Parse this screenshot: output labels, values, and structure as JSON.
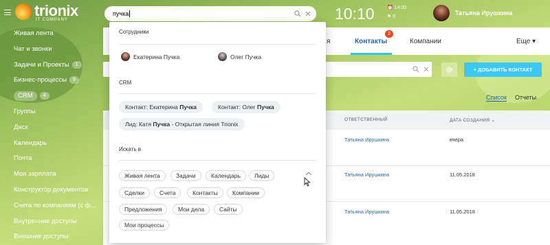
{
  "brand": {
    "name": "trionix",
    "subtitle": "IT COMPANY"
  },
  "search": {
    "value": "пучка"
  },
  "header": {
    "time": "10:10",
    "alarm": "14:00",
    "flags": "0",
    "user_name": "Татьяна Ирушкина"
  },
  "sidebar": {
    "items": [
      {
        "label": "Живая лента",
        "count": ""
      },
      {
        "label": "Чат и звонки",
        "count": ""
      },
      {
        "label": "Задачи и Проекты",
        "count": "1"
      },
      {
        "label": "Бизнес-процессы",
        "count": "9"
      },
      {
        "label": "CRM",
        "count": "4"
      },
      {
        "label": "Группы",
        "count": ""
      },
      {
        "label": "Диск",
        "count": ""
      },
      {
        "label": "Календарь",
        "count": ""
      },
      {
        "label": "Почта",
        "count": ""
      },
      {
        "label": "Моя зарплата",
        "count": ""
      },
      {
        "label": "Конструктор документов",
        "count": ""
      },
      {
        "label": "Счета по компаниям (с ф...",
        "count": ""
      },
      {
        "label": "Внутренние доступы",
        "count": ""
      },
      {
        "label": "Внешние доступы",
        "count": ""
      }
    ]
  },
  "tabs": {
    "partial": "я",
    "contacts": "Контакты",
    "contacts_badge": "3",
    "companies": "Компании",
    "more": "Еще"
  },
  "toolbar": {
    "add_contact": "+ ДОБАВИТЬ КОНТАКТ"
  },
  "views": {
    "list": "Список",
    "reports": "Отчеты"
  },
  "table": {
    "headers": {
      "responsible": "ОТВЕТСТВЕННЫЙ",
      "created": "ДАТА СОЗДАНИЯ"
    },
    "rows": [
      {
        "responsible": "Татьяна Ирушкина",
        "created": "вчера"
      },
      {
        "responsible": "Татьяна Ирушкина",
        "created": "11.05.2018"
      },
      {
        "responsible": "Татьяна Ирушкина",
        "created": "11.05.2018"
      }
    ]
  },
  "dropdown": {
    "employees_title": "Сотрудники",
    "employees": [
      "Екатерина Пучка",
      "Олег Пучка"
    ],
    "crm_title": "CRM",
    "crm_results": [
      {
        "prefix": "Контакт: Екатерина ",
        "bold": "Пучка",
        "suffix": ""
      },
      {
        "prefix": "Контакт: Олег ",
        "bold": "Пучка",
        "suffix": ""
      },
      {
        "prefix": "Лид: Катя ",
        "bold": "Пучка",
        "suffix": " - Открытая линия Trionix"
      }
    ],
    "search_in_title": "Искать в",
    "search_in": [
      "Живая лента",
      "Задачи",
      "Календарь",
      "Лиды",
      "Сделки",
      "Счета",
      "Контакты",
      "Компании",
      "Предложения",
      "Мои дела",
      "Сайты",
      "Мои процессы"
    ]
  },
  "colors": {
    "accent": "#2fc6f6",
    "link": "#2067b0",
    "badge": "#f54819"
  }
}
